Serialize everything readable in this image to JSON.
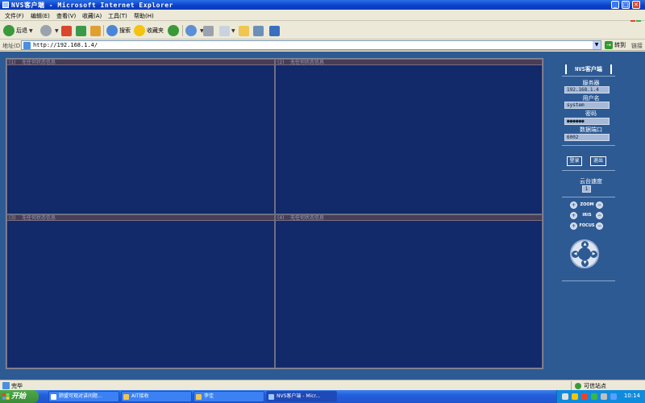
{
  "window": {
    "title": "NVS客户端 - Microsoft Internet Explorer",
    "controls": {
      "minimize": "_",
      "maximize": "□",
      "close": "✕"
    }
  },
  "menu": [
    {
      "label": "文件(F)"
    },
    {
      "label": "编辑(E)"
    },
    {
      "label": "查看(V)"
    },
    {
      "label": "收藏(A)"
    },
    {
      "label": "工具(T)"
    },
    {
      "label": "帮助(H)"
    }
  ],
  "toolbar": {
    "back_label": "后退",
    "search_label": "搜索",
    "favorites_label": "收藏夹"
  },
  "address": {
    "label": "地址(D)",
    "url": "http://192.168.1.4/",
    "go_label": "转到",
    "links_label": "链接"
  },
  "video": {
    "cells": [
      {
        "num": "(1)",
        "status": "无任何状态信息"
      },
      {
        "num": "(2)",
        "status": "无任何状态信息"
      },
      {
        "num": "(3)",
        "status": "无任何状态信息"
      },
      {
        "num": "(4)",
        "status": "无任何状态信息"
      }
    ]
  },
  "panel": {
    "title": "NVS客户端",
    "server_label": "服务器",
    "server_value": "192.168.1.4",
    "user_label": "用户名",
    "user_value": "system",
    "password_label": "密码",
    "password_value": "●●●●●●",
    "port_label": "数据端口",
    "port_value": "6002",
    "login_label": "登录",
    "logout_label": "退出",
    "ptz_speed_label": "云台速度",
    "ptz_speed_value": "1",
    "zoom_label": "ZOOM",
    "iris_label": "IRIS",
    "focus_label": "FOCUS"
  },
  "status": {
    "text": "完毕",
    "zone": "可信站点"
  },
  "taskbar": {
    "start_label": "开始",
    "tasks": [
      {
        "label": "肺盟可观对讲间题..."
      },
      {
        "label": "AIT接收"
      },
      {
        "label": "李佳"
      },
      {
        "label": "NVS客户端 - Micr..."
      }
    ],
    "clock": "10:14"
  }
}
